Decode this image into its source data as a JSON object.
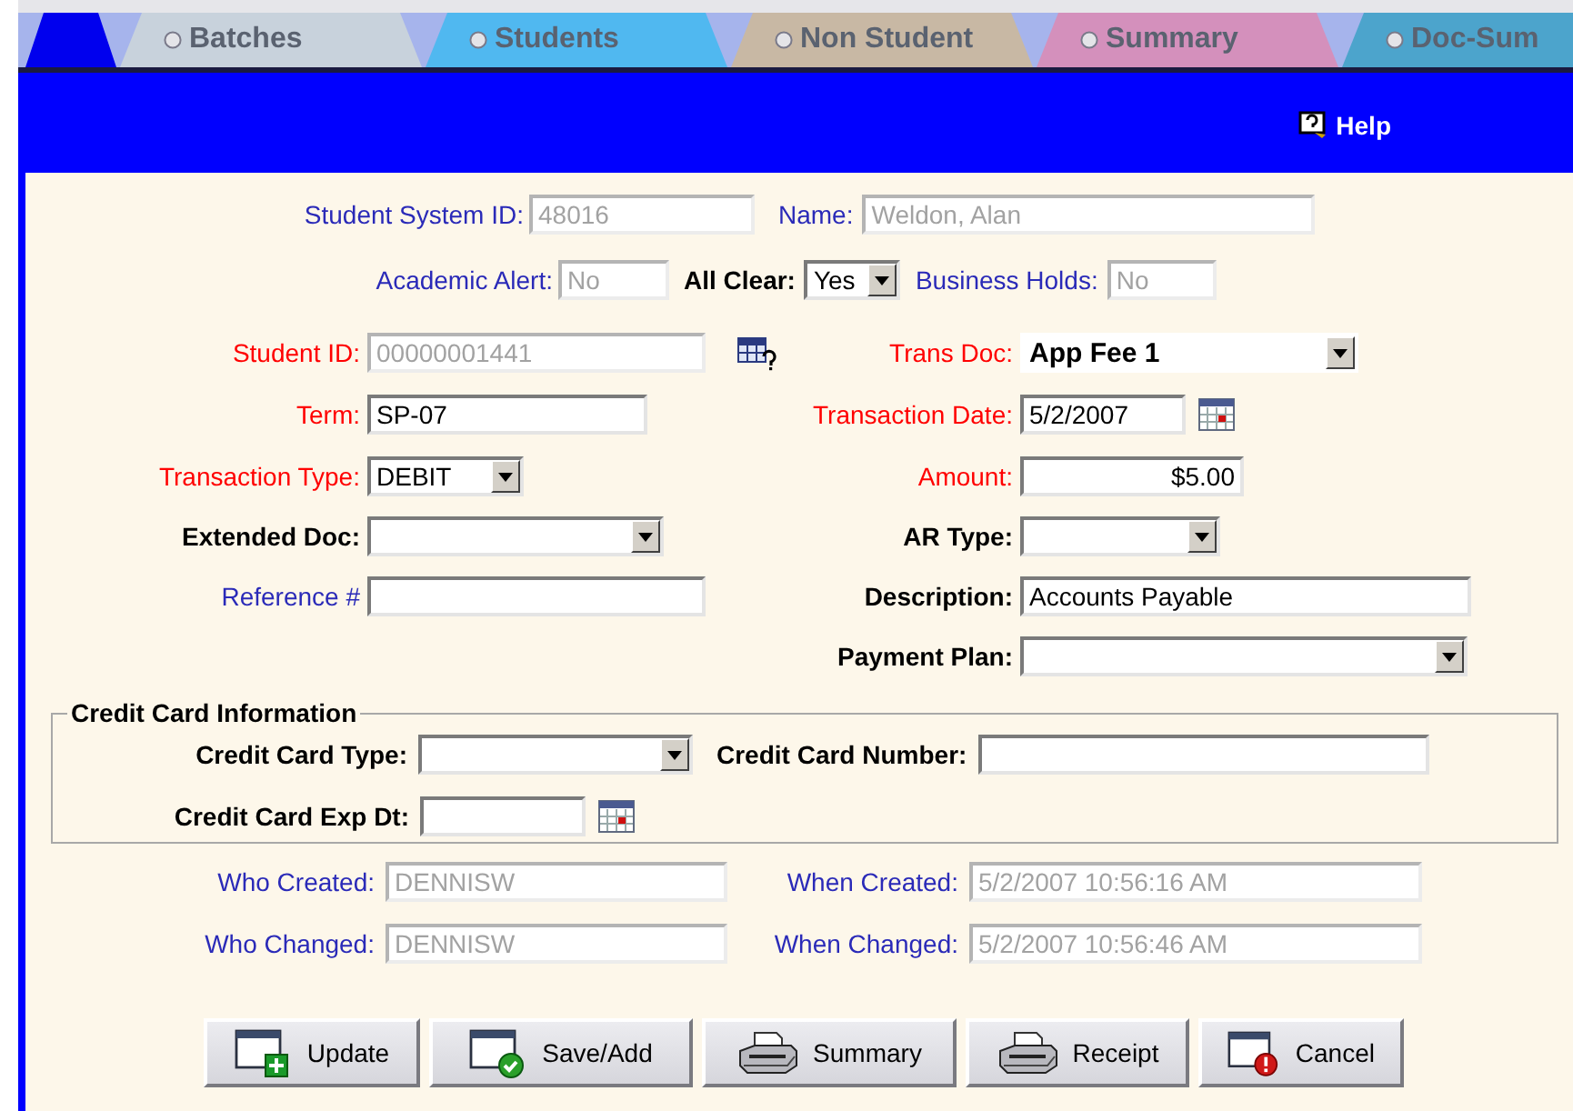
{
  "tabs": [
    {
      "label": "Batches",
      "color": "#c8d2dc",
      "selected": false
    },
    {
      "label": "Students",
      "color": "#50b8f0",
      "selected": false
    },
    {
      "label": "Non Student",
      "color": "#c8b8a4",
      "selected": false
    },
    {
      "label": "Summary",
      "color": "#d490bc",
      "selected": false
    },
    {
      "label": "Doc-Sum",
      "color": "#4ca4cc",
      "selected": false
    }
  ],
  "help": "Help",
  "header_rows": [
    [
      {
        "label": "Student System ID:",
        "color": "#2a2ab8",
        "bold": false,
        "kind": "text",
        "value": "48016",
        "disabled": true
      },
      {
        "label": "Name:",
        "color": "#2a2ab8",
        "bold": false,
        "kind": "text",
        "value": "Weldon, Alan",
        "disabled": true
      }
    ],
    [
      {
        "label": "Academic Alert:",
        "color": "#2a2ab8",
        "bold": false,
        "kind": "text",
        "value": "No",
        "disabled": true
      },
      {
        "label": "All Clear:",
        "color": "#000000",
        "bold": true,
        "kind": "select",
        "value": "Yes",
        "disabled": false
      },
      {
        "label": "Business Holds:",
        "color": "#2a2ab8",
        "bold": false,
        "kind": "text",
        "value": "No",
        "disabled": true
      }
    ]
  ],
  "main_rows": [
    {
      "left": {
        "label": "Student ID:",
        "color": "#ff0000",
        "bold": false,
        "kind": "lookup",
        "value": "00000001441",
        "disabled": true
      },
      "right": {
        "label": "Trans Doc:",
        "color": "#ff0000",
        "bold": false,
        "kind": "flat_select",
        "value": "App Fee 1",
        "disabled": false
      }
    },
    {
      "left": {
        "label": "Term:",
        "color": "#ff0000",
        "bold": false,
        "kind": "text",
        "value": "SP-07",
        "disabled": false
      },
      "right": {
        "label": "Transaction Date:",
        "color": "#ff0000",
        "bold": false,
        "kind": "date",
        "value": "5/2/2007",
        "disabled": false
      }
    },
    {
      "left": {
        "label": "Transaction Type:",
        "color": "#ff0000",
        "bold": false,
        "kind": "select",
        "value": "DEBIT",
        "disabled": false
      },
      "right": {
        "label": "Amount:",
        "color": "#ff0000",
        "bold": false,
        "kind": "money",
        "value": "$5.00",
        "disabled": false
      }
    },
    {
      "left": {
        "label": "Extended Doc:",
        "color": "#000000",
        "bold": true,
        "kind": "select",
        "disabled": false
      },
      "right": {
        "label": "AR Type:",
        "color": "#000000",
        "bold": true,
        "kind": "select",
        "disabled": false
      }
    },
    {
      "left": {
        "label": "Reference #",
        "color": "#2a2ab8",
        "bold": false,
        "kind": "text",
        "disabled": false
      },
      "right": {
        "label": "Description:",
        "color": "#000000",
        "bold": true,
        "kind": "text",
        "value": "Accounts Payable",
        "disabled": false
      }
    },
    {
      "right": {
        "label": "Payment Plan:",
        "color": "#000000",
        "bold": true,
        "kind": "select",
        "disabled": false
      }
    }
  ],
  "credit_card": {
    "legend": "Credit Card Information",
    "rows": [
      [
        {
          "label": "Credit Card Type:",
          "color": "#000000",
          "bold": true,
          "kind": "select",
          "disabled": false
        },
        {
          "label": "Credit Card Number:",
          "color": "#000000",
          "bold": true,
          "kind": "text",
          "disabled": false
        }
      ],
      [
        {
          "label": "Credit Card Exp Dt:",
          "color": "#000000",
          "bold": true,
          "kind": "date",
          "disabled": false
        }
      ]
    ]
  },
  "audit_rows": [
    {
      "left": {
        "label": "Who Created:",
        "color": "#2a2ab8",
        "bold": false,
        "kind": "text",
        "value": "DENNISW",
        "disabled": true
      },
      "right": {
        "label": "When Created:",
        "color": "#2a2ab8",
        "bold": false,
        "kind": "text",
        "value": "5/2/2007 10:56:16 AM",
        "disabled": true
      }
    },
    {
      "left": {
        "label": "Who Changed:",
        "color": "#2a2ab8",
        "bold": false,
        "kind": "text",
        "value": "DENNISW",
        "disabled": true
      },
      "right": {
        "label": "When Changed:",
        "color": "#2a2ab8",
        "bold": false,
        "kind": "text",
        "value": "5/2/2007 10:56:46 AM",
        "disabled": true
      }
    }
  ],
  "buttons": [
    {
      "label": "Update",
      "kind": "add"
    },
    {
      "label": "Save/Add",
      "kind": "confirm"
    },
    {
      "label": "Summary",
      "kind": "print"
    },
    {
      "label": "Receipt",
      "kind": "print"
    },
    {
      "label": "Cancel",
      "kind": "alert"
    }
  ]
}
